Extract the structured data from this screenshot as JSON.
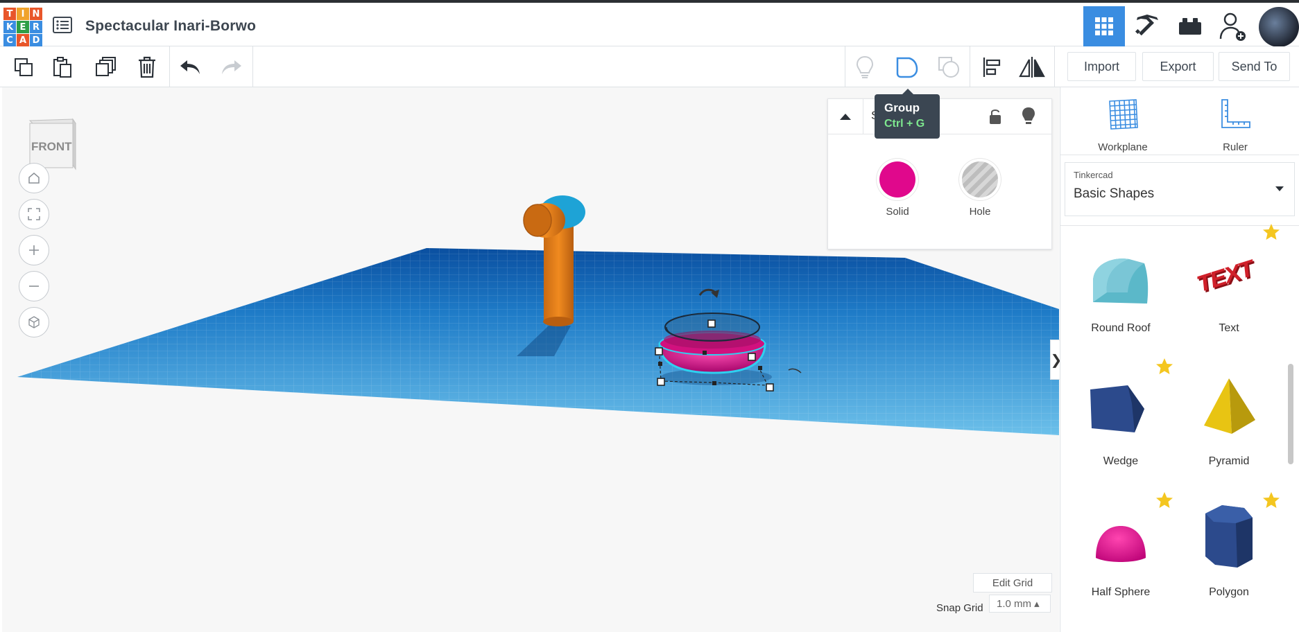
{
  "app": {
    "logo_letters": [
      "T",
      "I",
      "N",
      "K",
      "E",
      "R",
      "C",
      "A",
      "D"
    ],
    "logo_colors": [
      "#e8562a",
      "#f0a32b",
      "#e8562a",
      "#3a8de1",
      "#2e9e47",
      "#3a8de1",
      "#3a8de1",
      "#e8562a",
      "#3a8de1"
    ],
    "design_title": "Spectacular Inari-Borwo"
  },
  "header_right": {
    "icons": [
      "3d-view-grid-icon",
      "pickaxe-icon",
      "bricks-icon",
      "add-user-icon",
      "user-avatar"
    ],
    "active": "3d-view-grid-icon",
    "accent": "#3a8de1"
  },
  "toolbar": {
    "left_icons": [
      "copy-icon",
      "paste-icon",
      "duplicate-icon",
      "delete-icon",
      "undo-icon",
      "redo-icon"
    ],
    "right_icons": [
      "light-bulb-icon",
      "group-icon",
      "ungroup-icon",
      "align-icon",
      "mirror-icon"
    ],
    "import_label": "Import",
    "export_label": "Export",
    "send_to_label": "Send To"
  },
  "tooltip": {
    "title": "Group",
    "shortcut": "Ctrl + G"
  },
  "shape_panel": {
    "title_partial": "S",
    "title_suffix": ")",
    "solid_label": "Solid",
    "hole_label": "Hole",
    "solid_color": "#e0088c"
  },
  "viewcube": {
    "face_label": "FRONT"
  },
  "nav_controls": [
    "home-icon",
    "fit-view-icon",
    "zoom-in-icon",
    "zoom-out-icon",
    "ortho-view-icon"
  ],
  "grid": {
    "edit_label": "Edit Grid",
    "snap_label": "Snap Grid",
    "snap_value": "1.0 mm ▴"
  },
  "right_panel": {
    "workplane_label": "Workplane",
    "ruler_label": "Ruler",
    "library_source": "Tinkercad",
    "library_name": "Basic Shapes",
    "shapes": [
      {
        "label": "Round Roof",
        "color": "#5bb8c9"
      },
      {
        "label": "Text",
        "color": "#d0202a"
      },
      {
        "label": "Wedge",
        "color": "#2c4a8c"
      },
      {
        "label": "Pyramid",
        "color": "#e8c413"
      },
      {
        "label": "Half Sphere",
        "color": "#e0088c"
      },
      {
        "label": "Polygon",
        "color": "#2c4a8c"
      }
    ]
  }
}
